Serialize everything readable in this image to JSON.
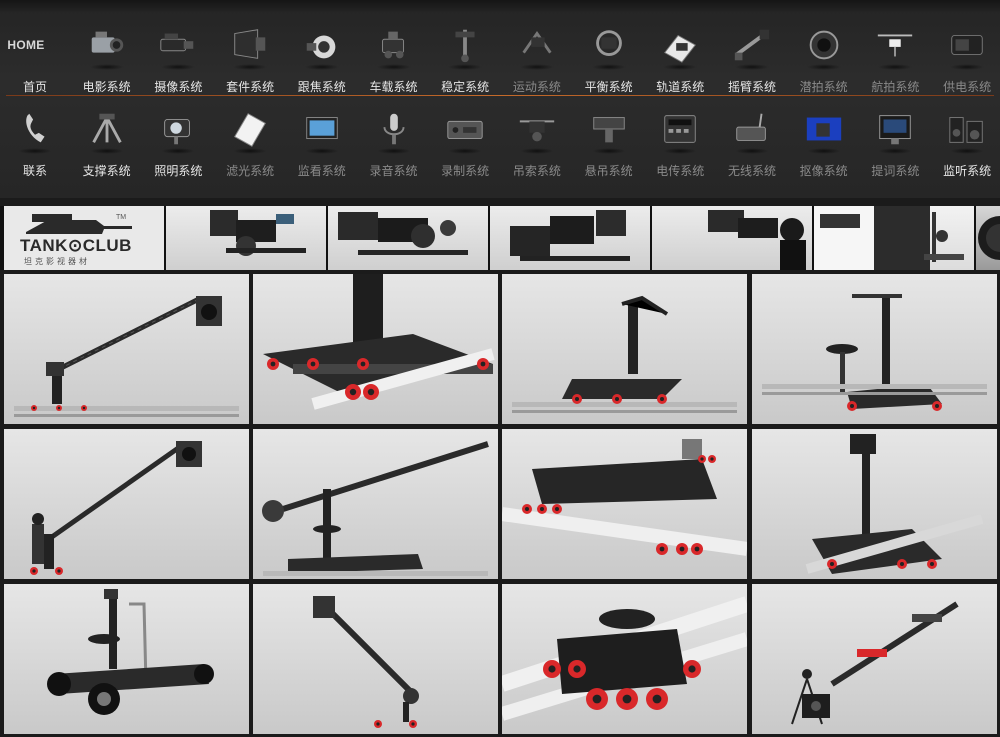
{
  "nav": {
    "home_text": "HOME",
    "row1": [
      {
        "id": "home",
        "label": "首页",
        "icon": "home-icon"
      },
      {
        "id": "film",
        "label": "电影系统",
        "icon": "cinema-camera-icon"
      },
      {
        "id": "camcorder",
        "label": "摄像系统",
        "icon": "camcorder-icon"
      },
      {
        "id": "kit",
        "label": "套件系统",
        "icon": "matte-box-icon"
      },
      {
        "id": "focus",
        "label": "跟焦系统",
        "icon": "follow-focus-icon"
      },
      {
        "id": "vehicle",
        "label": "车载系统",
        "icon": "car-mount-icon"
      },
      {
        "id": "stabilizer",
        "label": "稳定系统",
        "icon": "stabilizer-icon"
      },
      {
        "id": "motion",
        "label": "运动系统",
        "icon": "motion-rig-icon",
        "dim": true
      },
      {
        "id": "balance",
        "label": "平衡系统",
        "icon": "gimbal-icon"
      },
      {
        "id": "track",
        "label": "轨道系统",
        "icon": "track-dolly-icon"
      },
      {
        "id": "jib",
        "label": "摇臂系统",
        "icon": "jib-arm-icon"
      },
      {
        "id": "underwater",
        "label": "潜拍系统",
        "icon": "underwater-housing-icon",
        "dim": true
      },
      {
        "id": "aerial",
        "label": "航拍系统",
        "icon": "drone-icon",
        "dim": true
      },
      {
        "id": "power",
        "label": "供电系统",
        "icon": "battery-icon",
        "dim": true
      }
    ],
    "row2": [
      {
        "id": "contact",
        "label": "联系",
        "icon": "phone-icon"
      },
      {
        "id": "support",
        "label": "支撑系统",
        "icon": "tripod-icon"
      },
      {
        "id": "lighting",
        "label": "照明系统",
        "icon": "spotlight-icon"
      },
      {
        "id": "diffusion",
        "label": "滤光系统",
        "icon": "reflector-icon",
        "dim": true
      },
      {
        "id": "monitor",
        "label": "监看系统",
        "icon": "monitor-icon",
        "dim": true
      },
      {
        "id": "audio",
        "label": "录音系统",
        "icon": "microphone-icon",
        "dim": true
      },
      {
        "id": "record",
        "label": "录制系统",
        "icon": "recorder-icon",
        "dim": true
      },
      {
        "id": "cable",
        "label": "吊索系统",
        "icon": "cable-cam-icon",
        "dim": true
      },
      {
        "id": "hanging",
        "label": "悬吊系统",
        "icon": "hanging-rig-icon",
        "dim": true
      },
      {
        "id": "transmit",
        "label": "电传系统",
        "icon": "control-panel-icon",
        "dim": true
      },
      {
        "id": "wireless",
        "label": "无线系统",
        "icon": "wireless-transmitter-icon",
        "dim": true
      },
      {
        "id": "keying",
        "label": "抠像系统",
        "icon": "chroma-key-icon",
        "dim": true
      },
      {
        "id": "prompter",
        "label": "提词系统",
        "icon": "teleprompter-icon",
        "dim": true
      },
      {
        "id": "listen",
        "label": "监听系统",
        "icon": "speakers-icon"
      }
    ]
  },
  "banner": {
    "logo_text": "TANK⊙CLUB",
    "logo_sub": "坦克影视器材",
    "logo_tm": "TM",
    "icon": "tank-logo-icon"
  },
  "grid": {
    "items": [
      {
        "name": "jib-crane-on-track",
        "kind": "jib"
      },
      {
        "name": "dolly-platform-closeup",
        "kind": "dolly"
      },
      {
        "name": "tripod-dolly-on-track",
        "kind": "tripod-dolly"
      },
      {
        "name": "seat-dolly-on-track",
        "kind": "seat-dolly"
      },
      {
        "name": "jib-crane-with-operator",
        "kind": "jib2"
      },
      {
        "name": "jib-arm-with-seat",
        "kind": "jib3"
      },
      {
        "name": "track-dolly-angle",
        "kind": "dolly2"
      },
      {
        "name": "monitor-seat-dolly",
        "kind": "seat-dolly2"
      },
      {
        "name": "wheeled-camera-cart",
        "kind": "cart"
      },
      {
        "name": "mini-jib-crane",
        "kind": "jib4"
      },
      {
        "name": "skater-dolly-plate",
        "kind": "skater"
      },
      {
        "name": "motorized-slider",
        "kind": "slider"
      }
    ]
  },
  "colors": {
    "accent_wheel": "#d9282a",
    "divider": "#c56a2a",
    "nav_bg": "#282828"
  }
}
